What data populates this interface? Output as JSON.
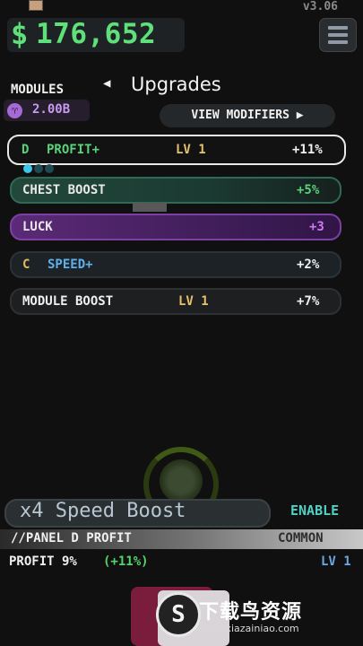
{
  "header": {
    "version": "v3.06",
    "currency_symbol": "$",
    "money": "176,652"
  },
  "modules": {
    "label": "MODULES",
    "currency_icon_glyph": "♈",
    "currency_value": "2.00B"
  },
  "nav": {
    "back_glyph": "◀",
    "title": "Upgrades",
    "view_modifiers": "VIEW MODIFIERS ▶"
  },
  "rows": [
    {
      "grade": "D",
      "name": "PROFIT+",
      "level": "LV 1",
      "bonus": "+11%",
      "grade_color": "#59d27a",
      "name_color": "#59d27a"
    },
    {
      "grade": "",
      "name": "CHEST BOOST",
      "level": "",
      "bonus": "+5%",
      "name_color": "#e8e8e8",
      "bonus_color": "#59d27a"
    },
    {
      "grade": "",
      "name": "LUCK",
      "level": "",
      "bonus": "+3",
      "name_color": "#e8e8e8",
      "bonus_color": "#c87bf0"
    },
    {
      "grade": "C",
      "name": "SPEED+",
      "level": "",
      "bonus": "+2%",
      "grade_color": "#e6b85c",
      "name_color": "#5fb0e8"
    },
    {
      "grade": "",
      "name": "MODULE BOOST",
      "level": "LV 1",
      "bonus": "+7%",
      "name_color": "#f0f0f0"
    }
  ],
  "progress_dots": {
    "filled": 1,
    "total": 3,
    "filled_color": "#3cc6ea",
    "empty_color": "#1e4a52"
  },
  "speed_boost": {
    "label": "x4 Speed Boost",
    "enable": "ENABLE"
  },
  "panel": {
    "title": "//PANEL D PROFIT",
    "rarity": "COMMON",
    "stat": "PROFIT 9%",
    "bonus": "(+11%)",
    "level": "LV 1"
  },
  "watermark": {
    "title": "下载鸟资源",
    "url": "www.xiazainiao.com"
  },
  "colors": {
    "money": "#5ee07a",
    "accent_teal": "#4fd2c4"
  }
}
